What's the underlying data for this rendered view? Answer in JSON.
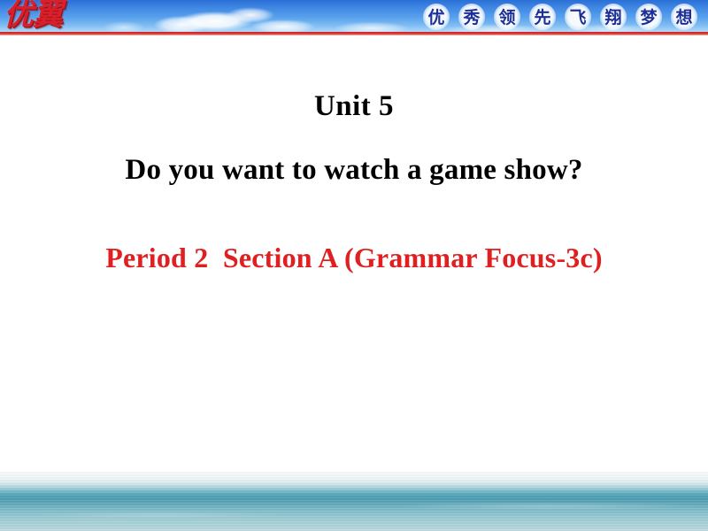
{
  "slide": {
    "background_color": "#ffffff",
    "header": {
      "logo_text": "优翼",
      "logo_color": "#d9202a",
      "band_color": "#3e86e2",
      "underline_color": "#c8202a",
      "slogan_chars": [
        "优",
        "秀",
        "领",
        "先",
        "飞",
        "翔",
        "梦",
        "想"
      ],
      "slogan_color": "#1c2f96"
    },
    "body": {
      "unit_title": "Unit 5",
      "lesson_question": "Do you want to watch a game show?",
      "period_section": "Period 2  Section A (Grammar Focus-3c)",
      "unit_title_color": "#000000",
      "lesson_question_color": "#000000",
      "period_section_color": "#e02020"
    },
    "footer": {
      "image_name": "sea-horizon-photo",
      "water_color": "#4f9fb4"
    }
  }
}
